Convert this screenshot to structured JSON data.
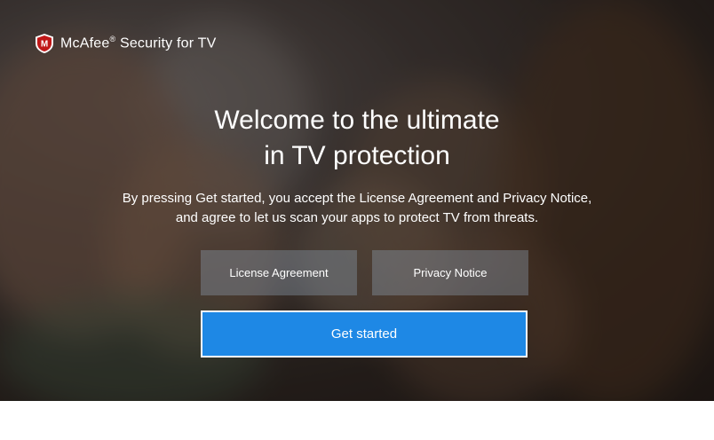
{
  "app": {
    "brand": "McAfee",
    "brand_mark": "®",
    "brand_suffix": " Security for TV"
  },
  "welcome": {
    "title_line1": "Welcome to the ultimate",
    "title_line2": "in TV protection",
    "desc_line1": "By pressing Get started, you accept the License Agreement and Privacy Notice,",
    "desc_line2": "and agree to let us scan your apps to protect TV from threats."
  },
  "buttons": {
    "license": "License Agreement",
    "privacy": "Privacy Notice",
    "get_started": "Get started"
  },
  "colors": {
    "primary": "#1e88e5",
    "brand_red": "#c01818"
  },
  "icons": {
    "logo": "mcafee-shield-icon"
  }
}
